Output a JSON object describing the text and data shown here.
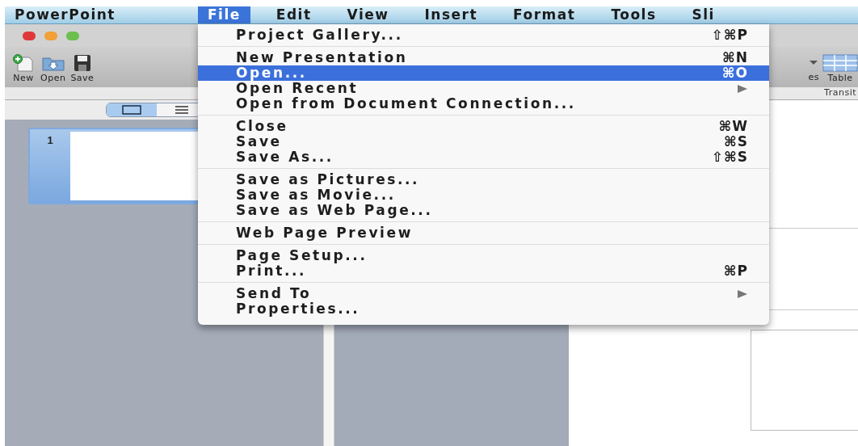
{
  "menu_bar": [
    {
      "label": "PowerPoint",
      "kind": "app",
      "selected": false
    },
    {
      "label": "File",
      "kind": "menu",
      "selected": true
    },
    {
      "label": "Edit",
      "kind": "menu",
      "selected": false
    },
    {
      "label": "View",
      "kind": "menu",
      "selected": false
    },
    {
      "label": "Insert",
      "kind": "menu",
      "selected": false
    },
    {
      "label": "Format",
      "kind": "menu",
      "selected": false
    },
    {
      "label": "Tools",
      "kind": "menu",
      "selected": false
    },
    {
      "label": "Sli",
      "kind": "menu",
      "selected": false
    }
  ],
  "toolbar": {
    "buttons": [
      {
        "label": "New",
        "kind": "new"
      },
      {
        "label": "Open",
        "kind": "open"
      },
      {
        "label": "Save",
        "kind": "save"
      }
    ],
    "right_buttons": [
      {
        "label": "es",
        "kind": "dropdown"
      },
      {
        "label": "Table",
        "kind": "table"
      }
    ]
  },
  "ribbon": {
    "tab": "Transit"
  },
  "view_toggle": [
    {
      "kind": "normal",
      "selected": true
    },
    {
      "kind": "outline",
      "selected": false
    }
  ],
  "slides": [
    {
      "number": "1",
      "selected": true
    }
  ],
  "file_menu": {
    "groups": [
      [
        {
          "label": "Project Gallery...",
          "shortcut": "⇧⌘P",
          "submenu": false,
          "selected": false
        }
      ],
      [
        {
          "label": "New Presentation",
          "shortcut": "⌘N",
          "submenu": false,
          "selected": false
        },
        {
          "label": "Open...",
          "shortcut": "⌘O",
          "submenu": false,
          "selected": true
        },
        {
          "label": "Open Recent",
          "submenu": true,
          "selected": false
        },
        {
          "label": "Open from Document Connection...",
          "submenu": false,
          "selected": false
        }
      ],
      [
        {
          "label": "Close",
          "shortcut": "⌘W",
          "submenu": false,
          "selected": false
        },
        {
          "label": "Save",
          "shortcut": "⌘S",
          "submenu": false,
          "selected": false
        },
        {
          "label": "Save As...",
          "shortcut": "⇧⌘S",
          "submenu": false,
          "selected": false
        }
      ],
      [
        {
          "label": "Save as Pictures...",
          "submenu": false,
          "selected": false
        },
        {
          "label": "Save as Movie...",
          "submenu": false,
          "selected": false
        },
        {
          "label": "Save as Web Page...",
          "submenu": false,
          "selected": false
        }
      ],
      [
        {
          "label": "Web Page Preview",
          "submenu": false,
          "selected": false
        }
      ],
      [
        {
          "label": "Page Setup...",
          "submenu": false,
          "selected": false
        },
        {
          "label": "Print...",
          "shortcut": "⌘P",
          "submenu": false,
          "selected": false
        }
      ],
      [
        {
          "label": "Send To",
          "submenu": true,
          "selected": false
        },
        {
          "label": "Properties...",
          "submenu": false,
          "selected": false
        }
      ]
    ]
  }
}
